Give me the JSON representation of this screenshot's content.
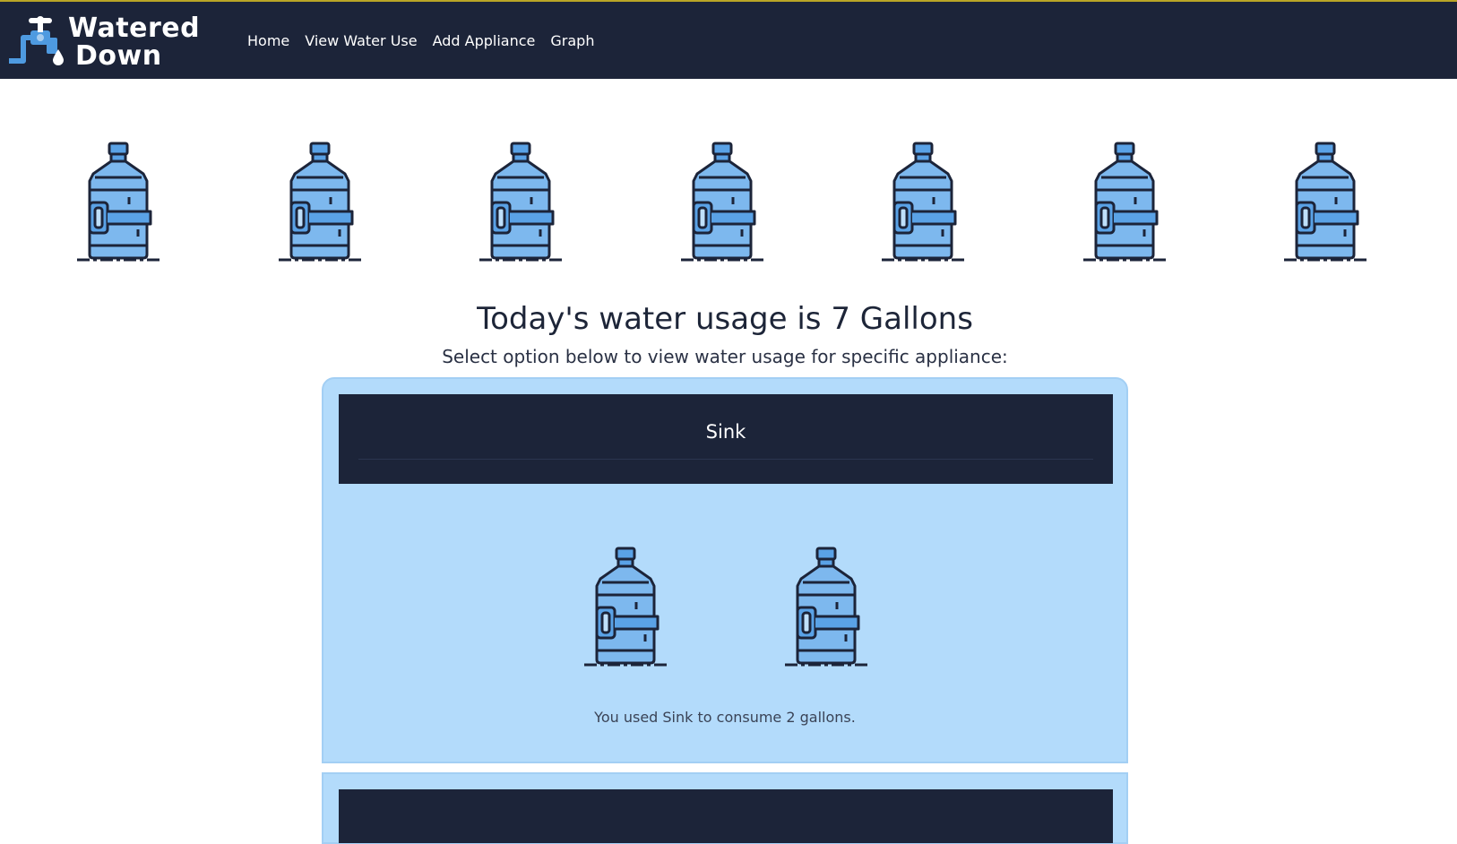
{
  "brand": {
    "name_line1": "Watered",
    "name_line2": "Down",
    "color_nav": "#1c2439",
    "color_card": "#b3dbfb",
    "color_bottle": "#5aa2e6"
  },
  "nav": {
    "items": [
      {
        "label": "Home"
      },
      {
        "label": "View Water Use"
      },
      {
        "label": "Add Appliance"
      },
      {
        "label": "Graph"
      }
    ]
  },
  "summary": {
    "gallons_today": 7,
    "headline": "Today's water usage is 7 Gallons",
    "subline": "Select option below to view water usage for specific appliance:"
  },
  "appliances": [
    {
      "name": "Sink",
      "gallons": 2,
      "caption": "You used Sink to consume 2 gallons."
    }
  ]
}
